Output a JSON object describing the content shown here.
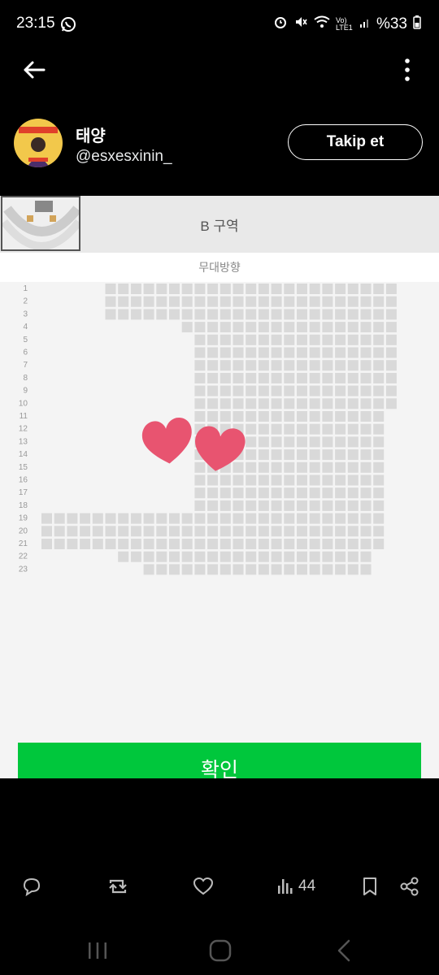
{
  "status_bar": {
    "time": "23:15",
    "battery": "%33",
    "network": "Vo) LTE1"
  },
  "profile": {
    "display_name": "태양",
    "handle": "@esxesxinin_",
    "follow_label": "Takip et"
  },
  "media": {
    "zone_label": "B 구역",
    "stage_direction": "무대방향",
    "confirm_label": "확인",
    "row_numbers": [
      "1",
      "2",
      "3",
      "4",
      "5",
      "6",
      "7",
      "8",
      "9",
      "10",
      "11",
      "12",
      "13",
      "14",
      "15",
      "16",
      "17",
      "18",
      "19",
      "20",
      "21",
      "22",
      "23"
    ]
  },
  "actions": {
    "view_count": "44"
  },
  "colors": {
    "confirm_green": "#00c73c",
    "heart_pink": "#e85470",
    "seat_gray": "#d9d9d9"
  }
}
